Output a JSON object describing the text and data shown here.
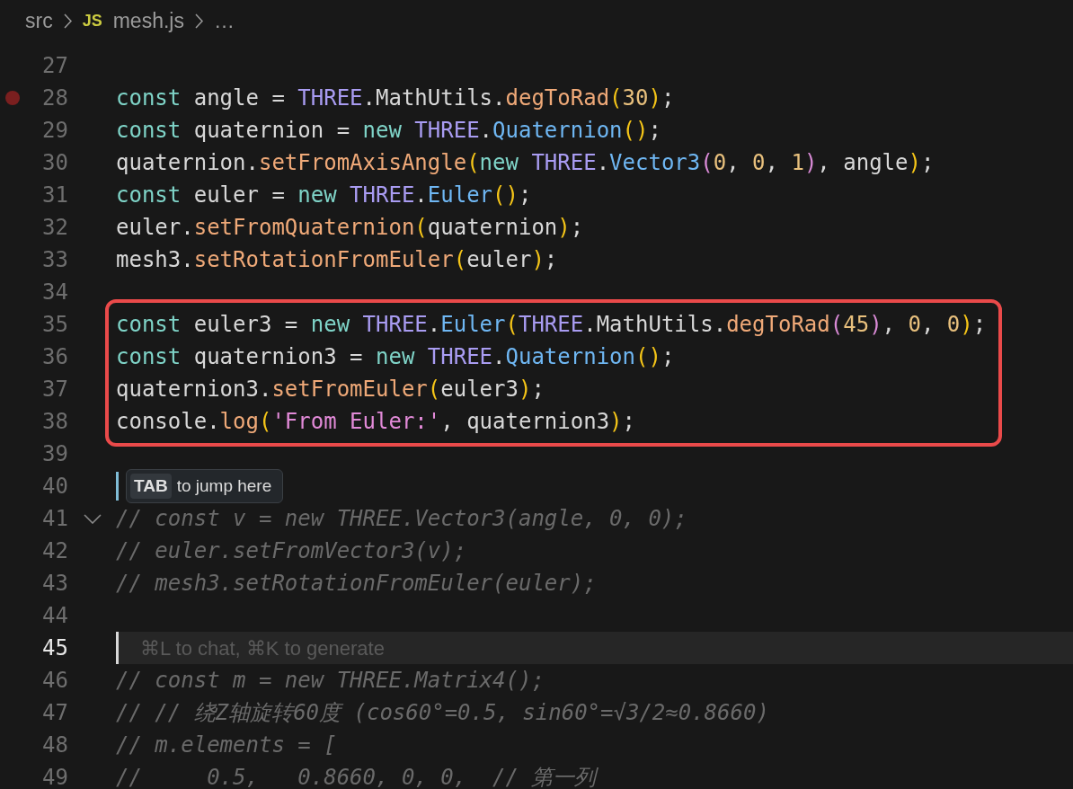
{
  "breadcrumb": {
    "folder": "src",
    "file_badge": "JS",
    "file": "mesh.js",
    "more": "…"
  },
  "lines": [
    {
      "number": "27",
      "breakpoint": false,
      "current": false,
      "boxed": false
    },
    {
      "number": "28",
      "breakpoint": true,
      "current": false,
      "boxed": false,
      "tokens": [
        {
          "text": "const",
          "kind": "keyword"
        },
        {
          "text": " angle = ",
          "kind": "plain"
        },
        {
          "text": "THREE",
          "kind": "class"
        },
        {
          "text": ".MathUtils.",
          "kind": "plain"
        },
        {
          "text": "degToRad",
          "kind": "method"
        },
        {
          "text": "(",
          "kind": "paren"
        },
        {
          "text": "30",
          "kind": "number"
        },
        {
          "text": ")",
          "kind": "paren"
        },
        {
          "text": ";",
          "kind": "plain"
        }
      ]
    },
    {
      "number": "29",
      "breakpoint": false,
      "current": false,
      "boxed": false,
      "tokens": [
        {
          "text": "const",
          "kind": "keyword"
        },
        {
          "text": " quaternion = ",
          "kind": "plain"
        },
        {
          "text": "new",
          "kind": "keyword"
        },
        {
          "text": " THREE",
          "kind": "class"
        },
        {
          "text": ".",
          "kind": "plain"
        },
        {
          "text": "Quaternion",
          "kind": "type"
        },
        {
          "text": "()",
          "kind": "paren"
        },
        {
          "text": ";",
          "kind": "plain"
        }
      ]
    },
    {
      "number": "30",
      "breakpoint": false,
      "current": false,
      "boxed": false,
      "tokens": [
        {
          "text": "quaternion.",
          "kind": "plain"
        },
        {
          "text": "setFromAxisAngle",
          "kind": "method"
        },
        {
          "text": "(",
          "kind": "paren"
        },
        {
          "text": "new",
          "kind": "keyword"
        },
        {
          "text": " THREE",
          "kind": "class"
        },
        {
          "text": ".",
          "kind": "plain"
        },
        {
          "text": "Vector3",
          "kind": "type"
        },
        {
          "text": "(",
          "kind": "paren2"
        },
        {
          "text": "0",
          "kind": "number"
        },
        {
          "text": ", ",
          "kind": "plain"
        },
        {
          "text": "0",
          "kind": "number"
        },
        {
          "text": ", ",
          "kind": "plain"
        },
        {
          "text": "1",
          "kind": "number"
        },
        {
          "text": ")",
          "kind": "paren2"
        },
        {
          "text": ", angle",
          "kind": "plain"
        },
        {
          "text": ")",
          "kind": "paren"
        },
        {
          "text": ";",
          "kind": "plain"
        }
      ]
    },
    {
      "number": "31",
      "breakpoint": false,
      "current": false,
      "boxed": false,
      "tokens": [
        {
          "text": "const",
          "kind": "keyword"
        },
        {
          "text": " euler = ",
          "kind": "plain"
        },
        {
          "text": "new",
          "kind": "keyword"
        },
        {
          "text": " THREE",
          "kind": "class"
        },
        {
          "text": ".",
          "kind": "plain"
        },
        {
          "text": "Euler",
          "kind": "type"
        },
        {
          "text": "()",
          "kind": "paren"
        },
        {
          "text": ";",
          "kind": "plain"
        }
      ]
    },
    {
      "number": "32",
      "breakpoint": false,
      "current": false,
      "boxed": false,
      "tokens": [
        {
          "text": "euler.",
          "kind": "plain"
        },
        {
          "text": "setFromQuaternion",
          "kind": "method"
        },
        {
          "text": "(",
          "kind": "paren"
        },
        {
          "text": "quaternion",
          "kind": "plain"
        },
        {
          "text": ")",
          "kind": "paren"
        },
        {
          "text": ";",
          "kind": "plain"
        }
      ]
    },
    {
      "number": "33",
      "breakpoint": false,
      "current": false,
      "boxed": false,
      "tokens": [
        {
          "text": "mesh3.",
          "kind": "plain"
        },
        {
          "text": "setRotationFromEuler",
          "kind": "method"
        },
        {
          "text": "(",
          "kind": "paren"
        },
        {
          "text": "euler",
          "kind": "plain"
        },
        {
          "text": ")",
          "kind": "paren"
        },
        {
          "text": ";",
          "kind": "plain"
        }
      ]
    },
    {
      "number": "34",
      "breakpoint": false,
      "current": false,
      "boxed": false
    },
    {
      "number": "35",
      "breakpoint": false,
      "current": false,
      "boxed": true,
      "tokens": [
        {
          "text": "const",
          "kind": "keyword"
        },
        {
          "text": " euler3 = ",
          "kind": "plain"
        },
        {
          "text": "new",
          "kind": "keyword"
        },
        {
          "text": " THREE",
          "kind": "class"
        },
        {
          "text": ".",
          "kind": "plain"
        },
        {
          "text": "Euler",
          "kind": "type"
        },
        {
          "text": "(",
          "kind": "paren"
        },
        {
          "text": "THREE",
          "kind": "class"
        },
        {
          "text": ".MathUtils.",
          "kind": "plain"
        },
        {
          "text": "degToRad",
          "kind": "method"
        },
        {
          "text": "(",
          "kind": "paren2"
        },
        {
          "text": "45",
          "kind": "number"
        },
        {
          "text": ")",
          "kind": "paren2"
        },
        {
          "text": ", ",
          "kind": "plain"
        },
        {
          "text": "0",
          "kind": "number"
        },
        {
          "text": ", ",
          "kind": "plain"
        },
        {
          "text": "0",
          "kind": "number"
        },
        {
          "text": ")",
          "kind": "paren"
        },
        {
          "text": ";",
          "kind": "plain"
        }
      ]
    },
    {
      "number": "36",
      "breakpoint": false,
      "current": false,
      "boxed": true,
      "tokens": [
        {
          "text": "const",
          "kind": "keyword"
        },
        {
          "text": " quaternion3 = ",
          "kind": "plain"
        },
        {
          "text": "new",
          "kind": "keyword"
        },
        {
          "text": " THREE",
          "kind": "class"
        },
        {
          "text": ".",
          "kind": "plain"
        },
        {
          "text": "Quaternion",
          "kind": "type"
        },
        {
          "text": "()",
          "kind": "paren"
        },
        {
          "text": ";",
          "kind": "plain"
        }
      ]
    },
    {
      "number": "37",
      "breakpoint": false,
      "current": false,
      "boxed": true,
      "tokens": [
        {
          "text": "quaternion3.",
          "kind": "plain"
        },
        {
          "text": "setFromEuler",
          "kind": "method"
        },
        {
          "text": "(",
          "kind": "paren"
        },
        {
          "text": "euler3",
          "kind": "plain"
        },
        {
          "text": ")",
          "kind": "paren"
        },
        {
          "text": ";",
          "kind": "plain"
        }
      ]
    },
    {
      "number": "38",
      "breakpoint": false,
      "current": false,
      "boxed": true,
      "tokens": [
        {
          "text": "console.",
          "kind": "plain"
        },
        {
          "text": "log",
          "kind": "method"
        },
        {
          "text": "(",
          "kind": "paren"
        },
        {
          "text": "'From Euler:'",
          "kind": "string"
        },
        {
          "text": ", quaternion3",
          "kind": "plain"
        },
        {
          "text": ")",
          "kind": "paren"
        },
        {
          "text": ";",
          "kind": "plain"
        }
      ]
    },
    {
      "number": "39",
      "breakpoint": false,
      "current": false,
      "boxed": false
    },
    {
      "number": "40",
      "breakpoint": false,
      "current": false,
      "boxed": false,
      "tooltip": {
        "key": "TAB",
        "text": "to jump here"
      }
    },
    {
      "number": "41",
      "breakpoint": false,
      "current": false,
      "boxed": false,
      "fold": {
        "expanded": true
      },
      "tokens": [
        {
          "text": "// const v = new THREE.Vector3(angle, 0, 0);",
          "kind": "comment"
        }
      ]
    },
    {
      "number": "42",
      "breakpoint": false,
      "current": false,
      "boxed": false,
      "tokens": [
        {
          "text": "// euler.setFromVector3(v);",
          "kind": "comment"
        }
      ]
    },
    {
      "number": "43",
      "breakpoint": false,
      "current": false,
      "boxed": false,
      "tokens": [
        {
          "text": "// mesh3.setRotationFromEuler(euler);",
          "kind": "comment"
        }
      ]
    },
    {
      "number": "44",
      "breakpoint": false,
      "current": false,
      "boxed": false
    },
    {
      "number": "45",
      "breakpoint": false,
      "current": true,
      "boxed": false,
      "hint": "⌘L to chat, ⌘K to generate"
    },
    {
      "number": "46",
      "breakpoint": false,
      "current": false,
      "boxed": false,
      "tokens": [
        {
          "text": "// const m = new THREE.Matrix4();",
          "kind": "comment"
        }
      ]
    },
    {
      "number": "47",
      "breakpoint": false,
      "current": false,
      "boxed": false,
      "tokens": [
        {
          "text": "// // 绕Z轴旋转60度 (cos60°=0.5, sin60°=√3/2≈0.8660)",
          "kind": "comment"
        }
      ]
    },
    {
      "number": "48",
      "breakpoint": false,
      "current": false,
      "boxed": false,
      "tokens": [
        {
          "text": "// m.elements = [",
          "kind": "comment"
        }
      ]
    },
    {
      "number": "49",
      "breakpoint": false,
      "current": false,
      "boxed": false,
      "tokens": [
        {
          "text": "//     0.5,   0.8660, 0, 0,  // 第一列",
          "kind": "comment"
        }
      ]
    }
  ]
}
